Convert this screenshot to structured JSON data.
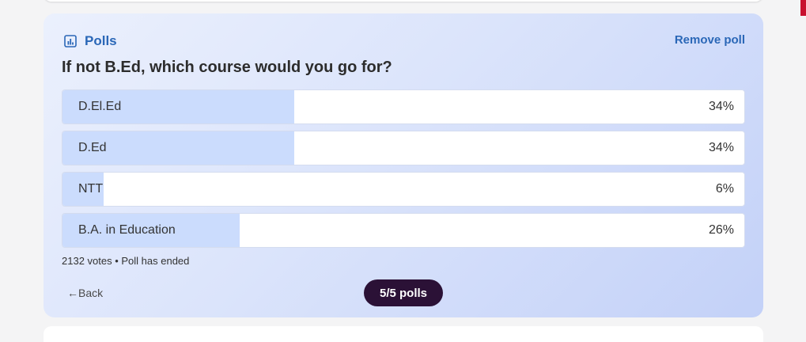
{
  "poll": {
    "header_label": "Polls",
    "header_icon": "bar-chart-icon",
    "remove_label": "Remove poll",
    "question": "If not B.Ed, which course would you go for?",
    "options": [
      {
        "label": "D.El.Ed",
        "percent_text": "34%",
        "percent": 34
      },
      {
        "label": "D.Ed",
        "percent_text": "34%",
        "percent": 34
      },
      {
        "label": "NTT",
        "percent_text": "6%",
        "percent": 6
      },
      {
        "label": "B.A. in Education",
        "percent_text": "26%",
        "percent": 26
      }
    ],
    "meta": "2132 votes • Poll has ended",
    "back_label": "←Back",
    "pager_label": "5/5 polls"
  },
  "colors": {
    "accent": "#2a67b7",
    "fill": "#cbdcfd",
    "pager_bg": "#2b1136"
  }
}
